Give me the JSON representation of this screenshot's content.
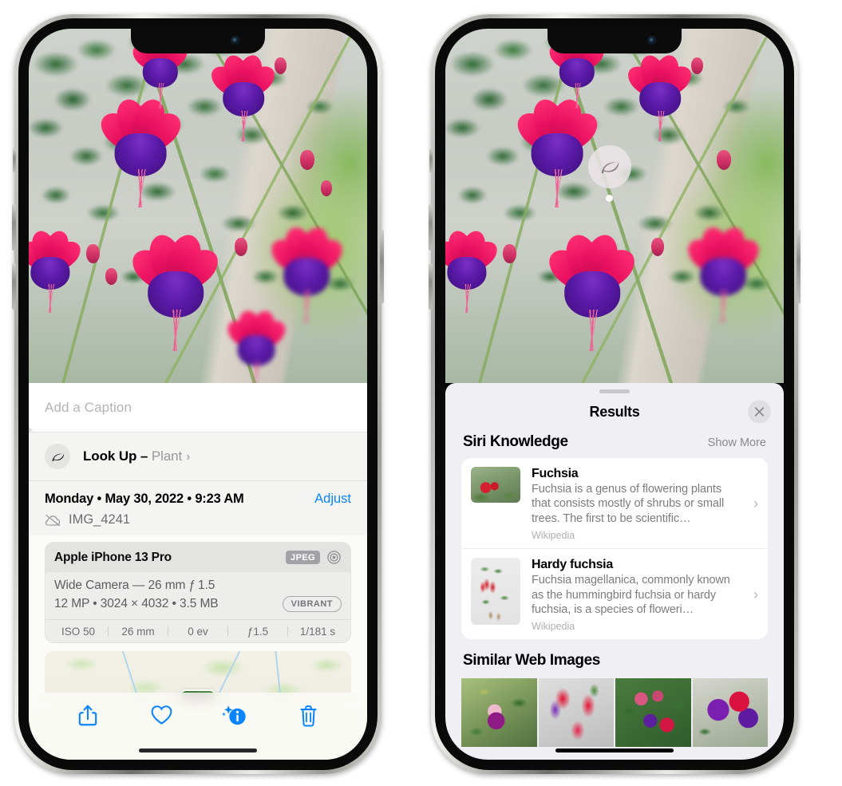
{
  "left_phone": {
    "caption": {
      "placeholder": "Add a Caption",
      "value": ""
    },
    "lookup": {
      "label": "Look Up – ",
      "subject": "Plant",
      "icon": "leaf-icon",
      "chevron": "›"
    },
    "metadata": {
      "date_line": "Monday • May 30, 2022 • 9:23 AM",
      "adjust_label": "Adjust",
      "filename": "IMG_4241",
      "cloud_icon": "cloud-slash-icon"
    },
    "exif": {
      "device": "Apple iPhone 13 Pro",
      "format_chip": "JPEG",
      "aperture_icon": "aperture-icon",
      "lens": "Wide Camera — 26 mm ƒ 1.5",
      "size_line": "12 MP • 3024 × 4032 • 3.5 MB",
      "style_chip": "VIBRANT",
      "stats": [
        "ISO 50",
        "26 mm",
        "0 ev",
        "ƒ1.5",
        "1/181 s"
      ]
    },
    "map": {
      "pin": "photo-pin"
    },
    "toolbar": [
      {
        "name": "share-button",
        "icon": "share-icon"
      },
      {
        "name": "favorite-button",
        "icon": "heart-icon"
      },
      {
        "name": "info-button",
        "icon": "info-sparkle-icon"
      },
      {
        "name": "delete-button",
        "icon": "trash-icon"
      }
    ]
  },
  "right_phone": {
    "photo_badge": {
      "icon": "leaf-icon"
    },
    "sheet": {
      "title": "Results",
      "close_label": "✕",
      "sections": [
        {
          "title": "Siri Knowledge",
          "action": "Show More",
          "items": [
            {
              "name": "Fuchsia",
              "description": "Fuchsia is a genus of flowering plants that consists mostly of shrubs or small trees. The first to be scientific…",
              "source": "Wikipedia",
              "chevron": "›"
            },
            {
              "name": "Hardy fuchsia",
              "description": "Fuchsia magellanica, commonly known as the hummingbird fuchsia or hardy fuchsia, is a species of floweri…",
              "source": "Wikipedia",
              "chevron": "›"
            }
          ]
        },
        {
          "title": "Similar Web Images",
          "action": "",
          "items": []
        }
      ]
    }
  },
  "colors": {
    "accent_blue": "#0a84ff",
    "sheet_bg": "#f0eff4",
    "card_bg": "#ffffff",
    "secondary_text": "#8a8a8e",
    "exif_bg": "#ededeb"
  }
}
